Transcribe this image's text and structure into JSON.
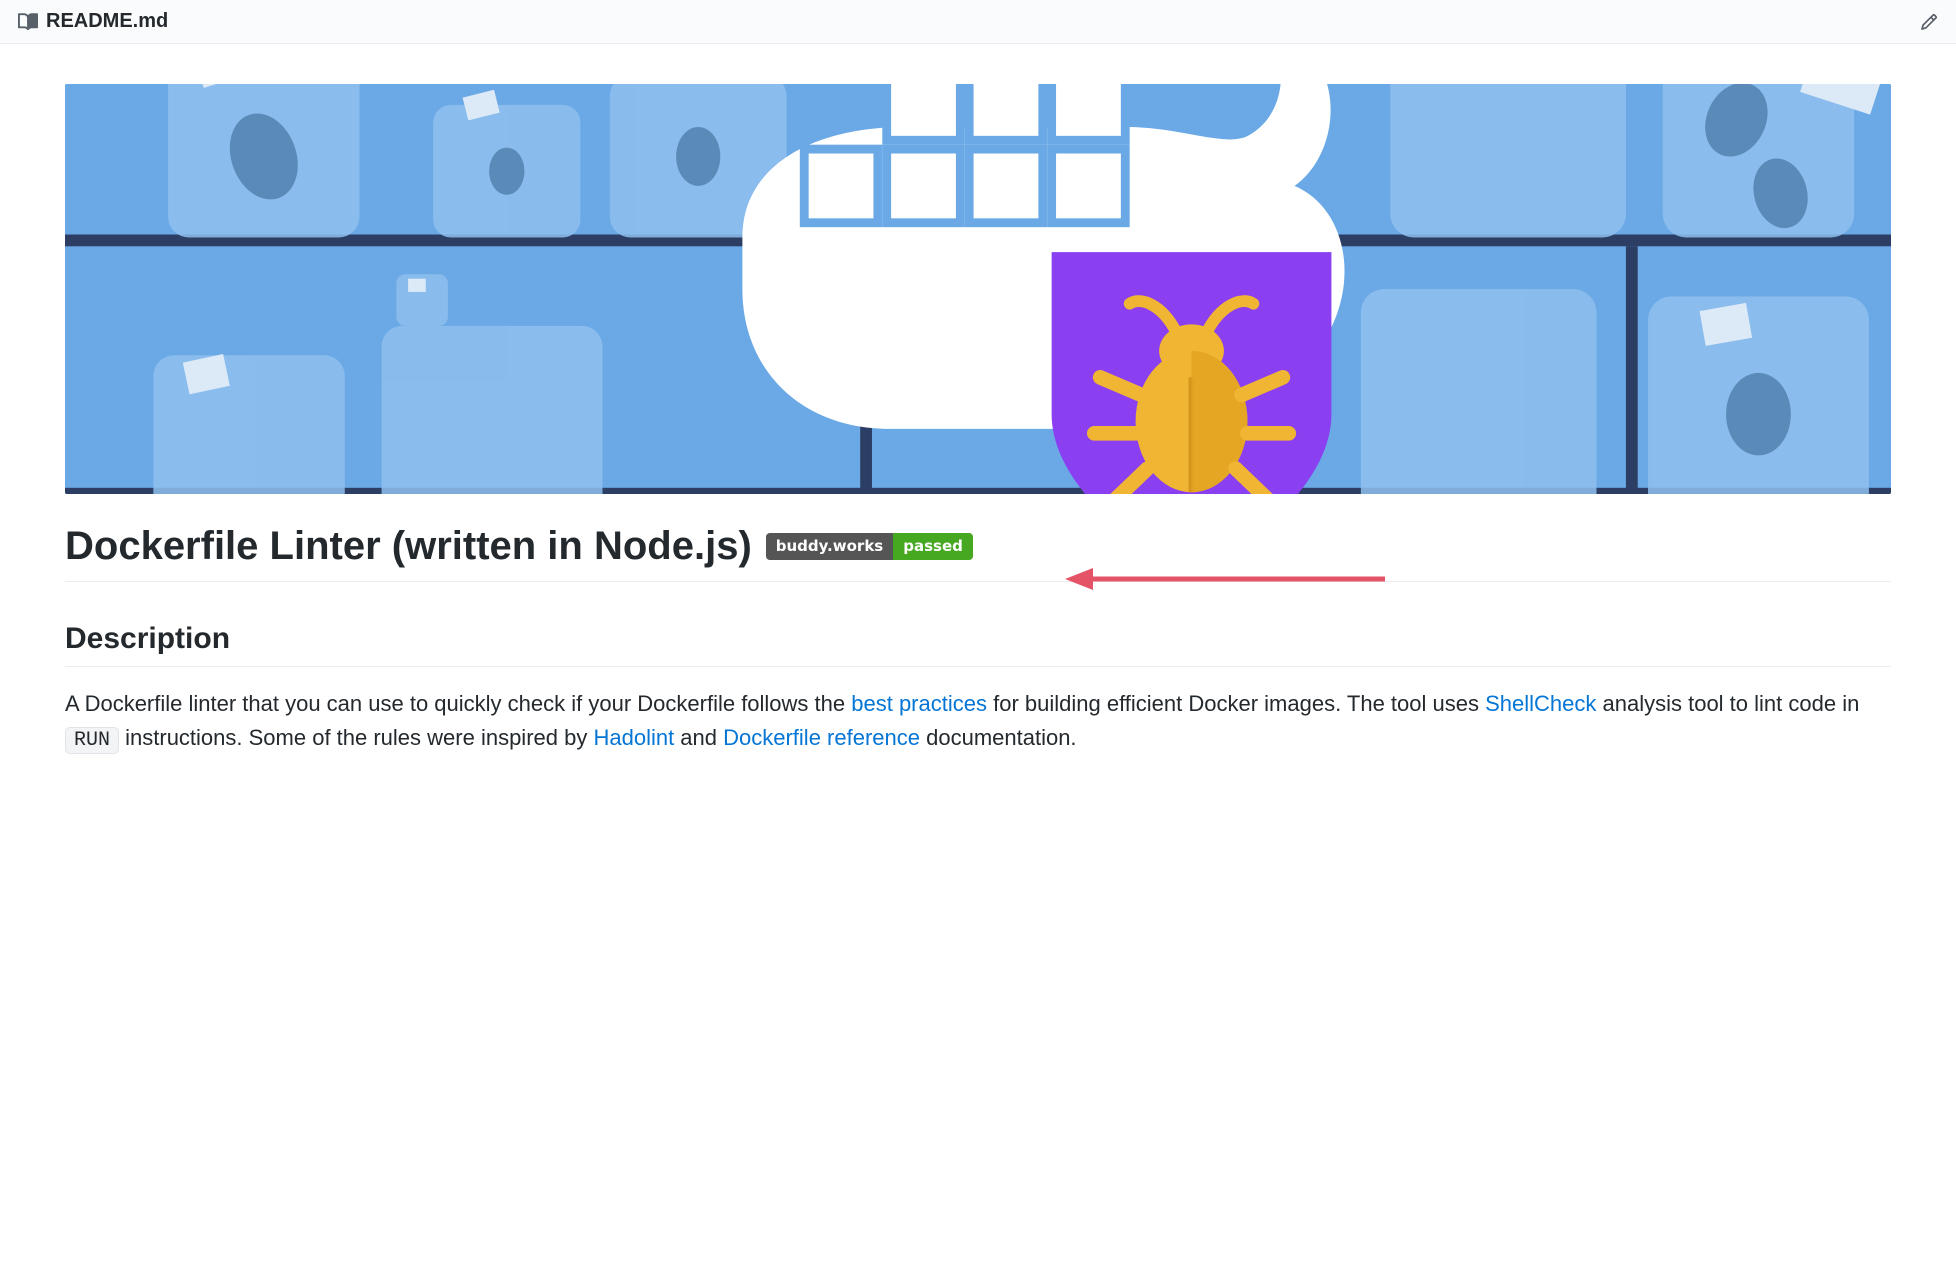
{
  "header": {
    "filename": "README.md"
  },
  "hero": {
    "alt": "Dockerfile Linter banner"
  },
  "title": "Dockerfile Linter (written in Node.js)",
  "badge": {
    "left": "buddy.works",
    "right": "passed"
  },
  "sections": {
    "description_heading": "Description"
  },
  "description": {
    "part1": "A Dockerfile linter that you can use to quickly check if your Dockerfile follows the ",
    "link1": "best practices",
    "part2": " for building efficient Docker images. The tool uses ",
    "link2": "ShellCheck",
    "part3": " analysis tool to lint code in ",
    "code1": "RUN",
    "part4": " instructions. Some of the rules were inspired by ",
    "link3": "Hadolint",
    "part5": " and ",
    "link4": "Dockerfile reference",
    "part6": " documentation."
  }
}
